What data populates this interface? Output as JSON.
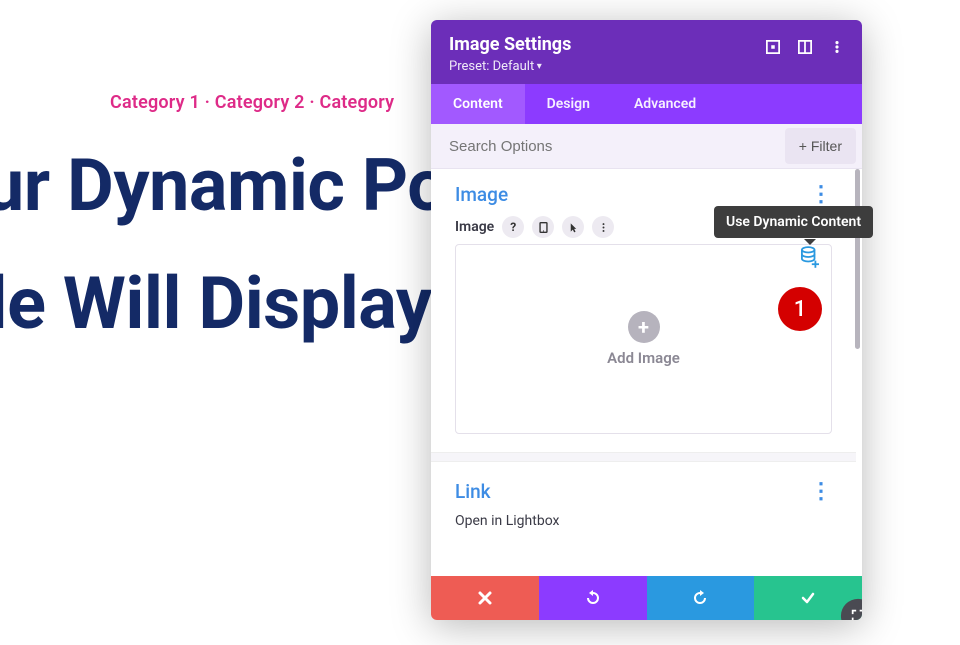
{
  "bg": {
    "categories": "Category 1 · Category 2 · Category",
    "title_line1": "Your Dynamic Post",
    "title_line2": "Title Will Display Here"
  },
  "panel": {
    "title": "Image Settings",
    "preset": "Preset: Default"
  },
  "tabs": {
    "content": "Content",
    "design": "Design",
    "advanced": "Advanced"
  },
  "search": {
    "placeholder": "Search Options",
    "filter": "Filter"
  },
  "image_section": {
    "title": "Image",
    "field_label": "Image",
    "add_label": "Add Image"
  },
  "link_section": {
    "title": "Link",
    "open_lightbox": "Open in Lightbox"
  },
  "tooltip": {
    "text": "Use Dynamic Content"
  },
  "badge": {
    "number": "1"
  }
}
